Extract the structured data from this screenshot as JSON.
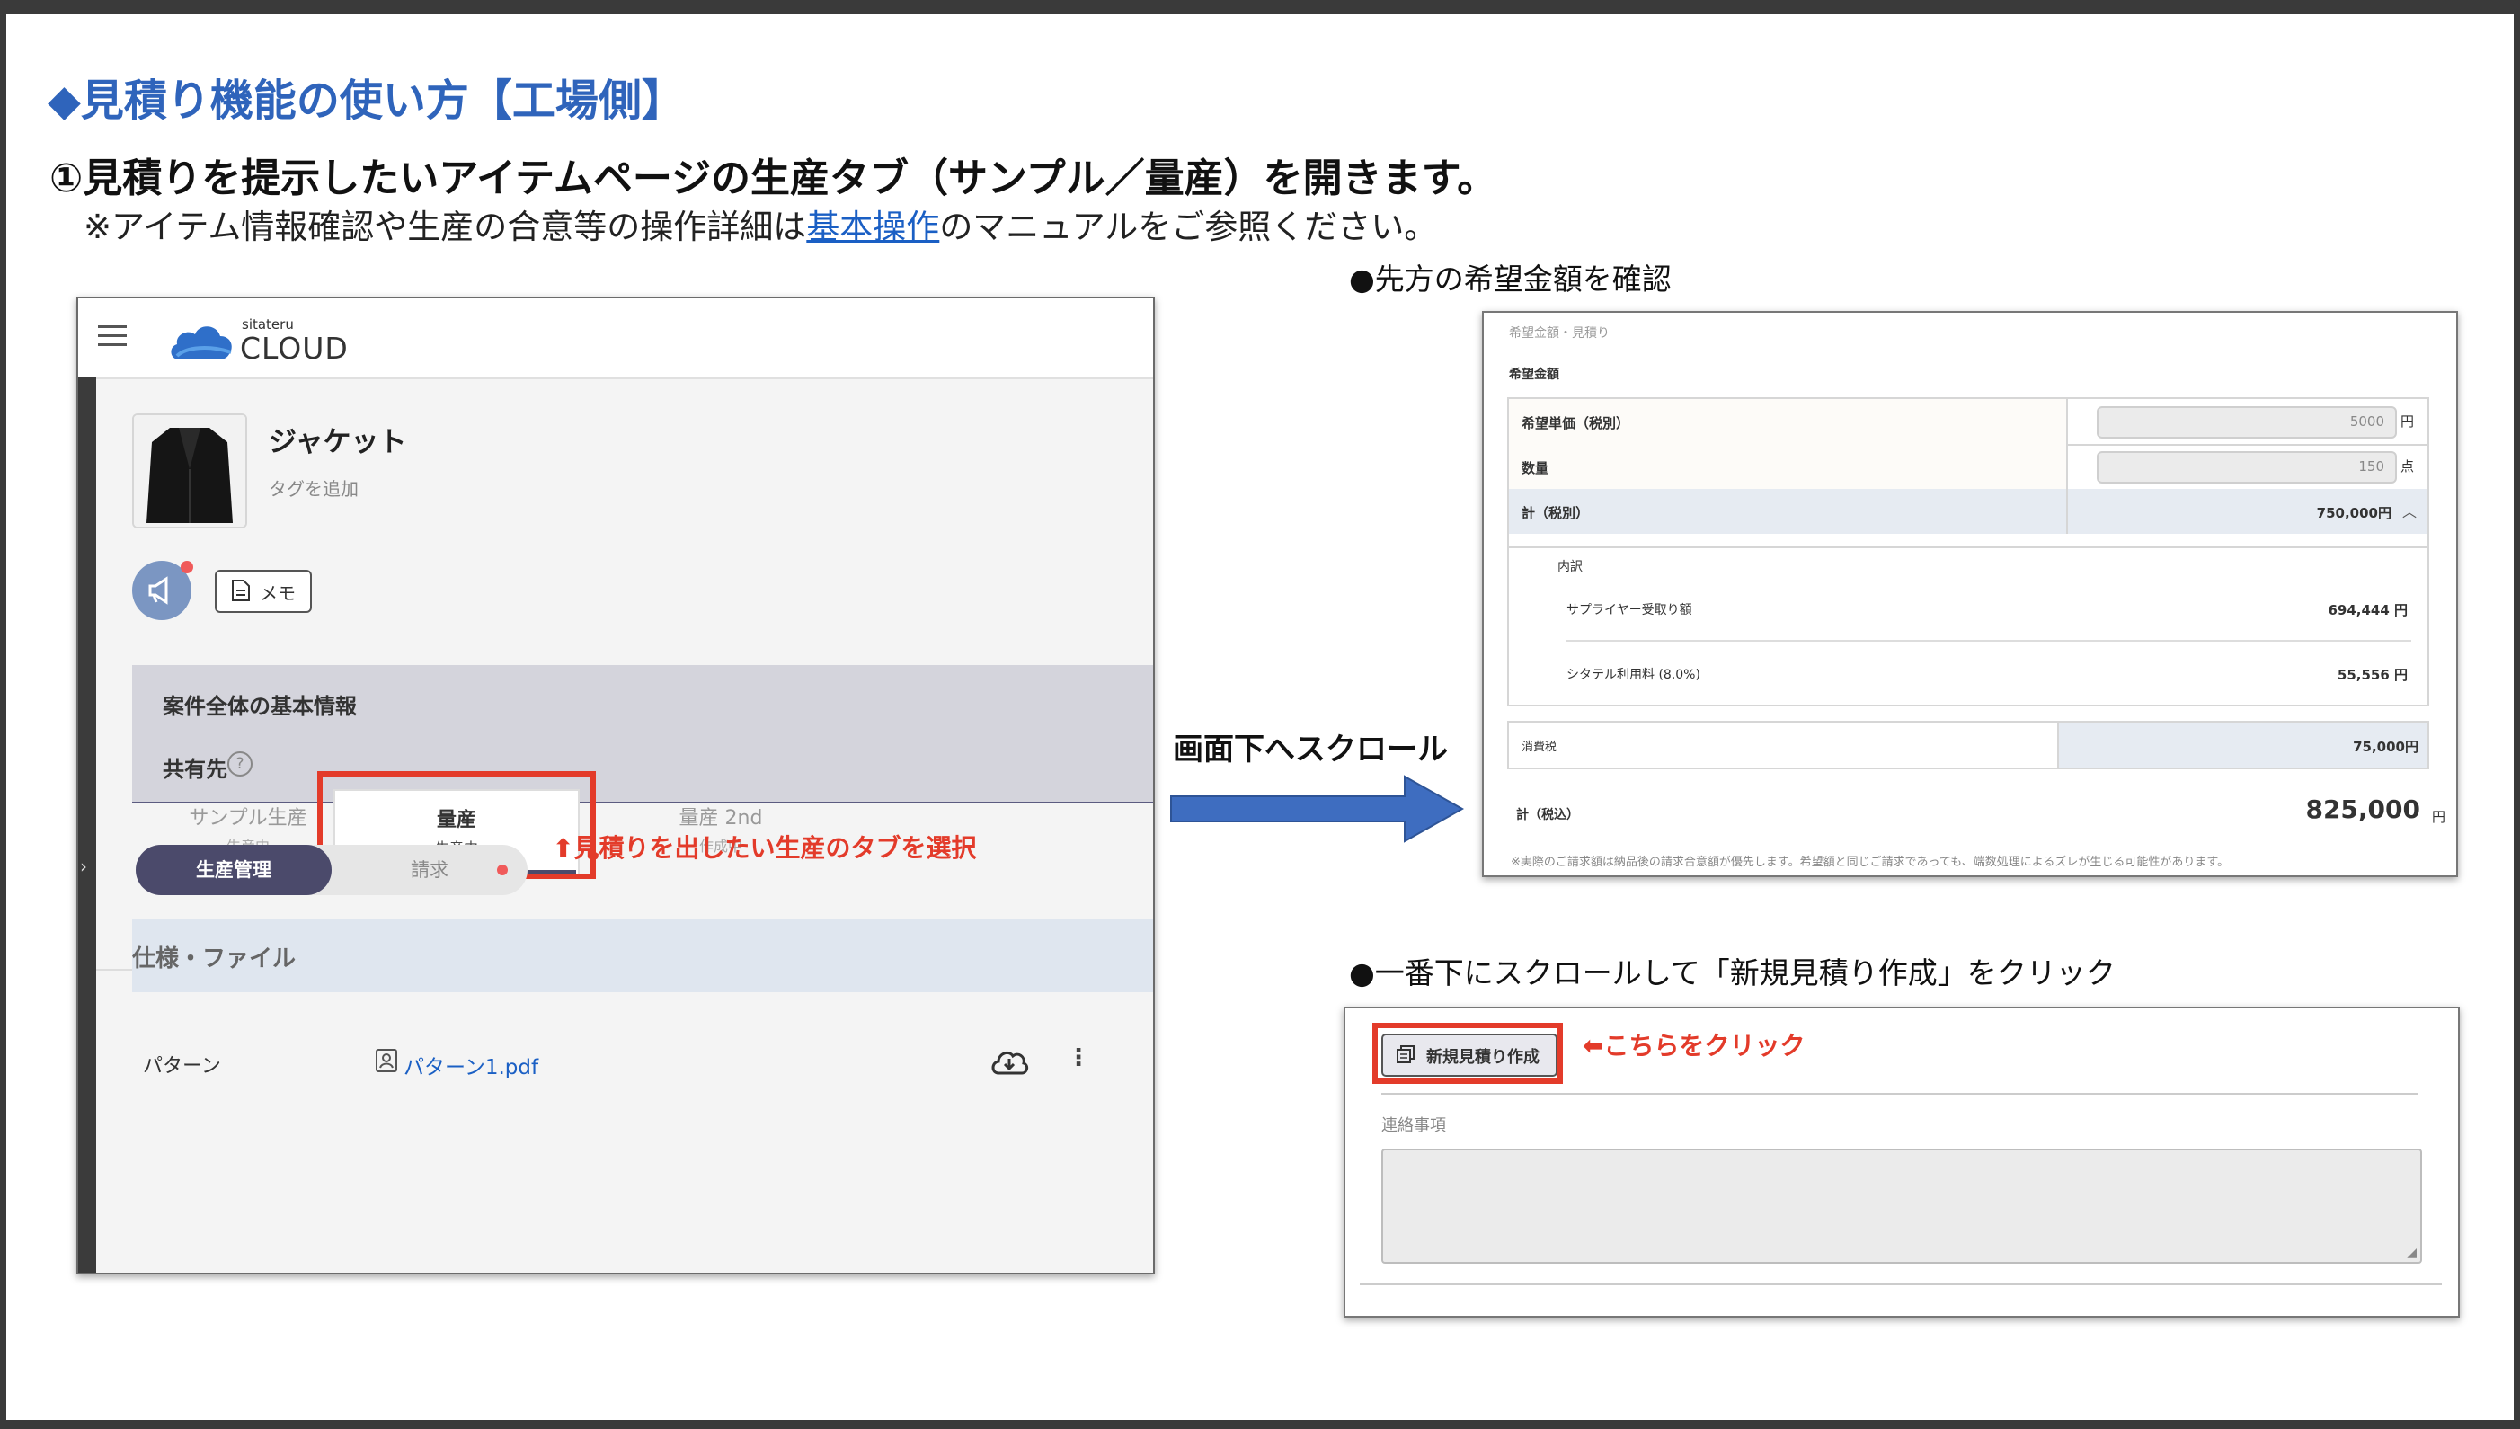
{
  "slide": {
    "title": "◆見積り機能の使い方【工場側】",
    "step": "①見積りを提示したいアイテムページの生産タブ（サンプル／量産）を開きます。",
    "note_prefix": "※アイテム情報確認や生産の合意等の操作詳細は",
    "note_link": "基本操作",
    "note_suffix": "のマニュアルをご参照ください。",
    "scroll_label": "画面下へスクロール",
    "caption_top": "●先方の希望金額を確認",
    "caption_bottom": "●一番下にスクロールして「新規見積り作成」をクリック",
    "annotation_tab": "⬆見積りを出したい生産のタブを選択",
    "annotation_click": "⬅こちらをクリック",
    "accent_color": "#2f64bb",
    "highlight_color": "#e33b2a"
  },
  "app": {
    "logo_sub": "sitateru",
    "logo_main": "CLOUD",
    "item_title": "ジャケット",
    "tag_add": "タグを追加",
    "memo_label": "メモ",
    "section_basic": "案件全体の基本情報",
    "section_share": "共有先",
    "help_icon": "?",
    "tabs": [
      {
        "label": "サンプル生産",
        "sub": "生産中"
      },
      {
        "label": "量産",
        "sub": "生産中"
      },
      {
        "label": "量産 2nd",
        "sub": "作成中"
      }
    ],
    "toggle_on": "生産管理",
    "toggle_off": "請求",
    "spec_section": "仕様・ファイル",
    "file_row_label": "パターン",
    "file_name": "パターン1.pdf",
    "icons": [
      "menu-icon",
      "cloud-logo-icon",
      "megaphone-icon",
      "memo-icon",
      "help-icon",
      "pdf-icon",
      "cloud-download-icon",
      "more-vertical-icon"
    ]
  },
  "estimate": {
    "header": "希望金額・見積り",
    "subheader": "希望金額",
    "unit_price_label": "希望単価（税別）",
    "unit_price_value": "5000",
    "unit_price_unit": "円",
    "qty_label": "数量",
    "qty_value": "150",
    "qty_unit": "点",
    "subtotal_label": "計（税別）",
    "subtotal_value": "750,000円",
    "breakdown_label": "内訳",
    "supplier_label": "サプライヤー受取り額",
    "supplier_value": "694,444 円",
    "fee_label": "シタテル利用料 (8.0%)",
    "fee_value": "55,556 円",
    "tax_label": "消費税",
    "tax_value": "75,000円",
    "total_label": "計（税込）",
    "total_value": "825,000",
    "total_unit": "円",
    "footnote": "※実際のご請求額は納品後の請求合意額が優先します。希望額と同じご請求であっても、端数処理によるズレが生じる可能性があります。"
  },
  "new_quote": {
    "button_label": "新規見積り作成",
    "contact_label": "連絡事項"
  }
}
